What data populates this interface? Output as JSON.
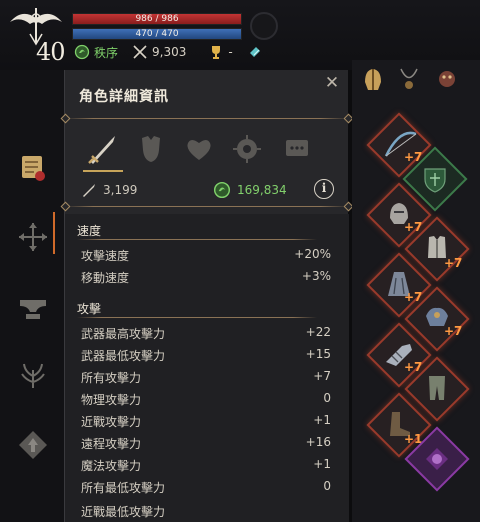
{
  "hud": {
    "level": "40",
    "hp": {
      "text": "986 / 986",
      "fraction": 1.0,
      "color": "#c33434"
    },
    "mp": {
      "text": "470 / 470",
      "fraction": 1.0,
      "color": "#3f70b8"
    },
    "alignment": "秩序",
    "combat_power": "9,303",
    "trophy_value": "-",
    "icons": [
      "class-emblem-icon",
      "alignment-icon",
      "crossed-swords-icon",
      "trophy-icon",
      "crystal-icon"
    ]
  },
  "panel": {
    "title": "角色詳細資訊",
    "close_icon": "close-icon",
    "category_tabs": [
      {
        "icon": "sword-icon",
        "selected": true
      },
      {
        "icon": "armor-icon",
        "selected": false
      },
      {
        "icon": "heart-icon",
        "selected": false
      },
      {
        "icon": "emblem-icon",
        "selected": false
      },
      {
        "icon": "chat-box-icon",
        "selected": false
      }
    ],
    "power_row": {
      "attack_power": "3,199",
      "alignment_value": "169,834",
      "info_label": "i"
    },
    "sections": [
      {
        "title": "速度",
        "rows": [
          {
            "label": "攻擊速度",
            "value": "+20%"
          },
          {
            "label": "移動速度",
            "value": "+3%"
          }
        ]
      },
      {
        "title": "攻擊",
        "rows": [
          {
            "label": "武器最高攻擊力",
            "value": "+22"
          },
          {
            "label": "武器最低攻擊力",
            "value": "+15"
          },
          {
            "label": "所有攻擊力",
            "value": "+7"
          },
          {
            "label": "物理攻擊力",
            "value": "0"
          },
          {
            "label": "近戰攻擊力",
            "value": "+1"
          },
          {
            "label": "遠程攻擊力",
            "value": "+16"
          },
          {
            "label": "魔法攻擊力",
            "value": "+1"
          },
          {
            "label": "所有最低攻擊力",
            "value": "0"
          },
          {
            "label": "近戰最低攻擊力",
            "value": ""
          }
        ]
      }
    ]
  },
  "left_nav": [
    {
      "icon": "scroll-icon",
      "active": true
    },
    {
      "icon": "move-arrows-icon",
      "active": false
    },
    {
      "icon": "anvil-icon",
      "active": false
    },
    {
      "icon": "tree-icon",
      "active": false
    },
    {
      "icon": "diamond-up-icon",
      "active": false
    }
  ],
  "equipment": {
    "tabs": [
      "helmet-tab-icon",
      "necklace-tab-icon",
      "creature-tab-icon"
    ],
    "slots": [
      {
        "item": "bow-icon",
        "enhance": "+7"
      },
      {
        "item": "shield-crest-icon",
        "enhance": ""
      },
      {
        "item": "helmet-icon",
        "enhance": "+7"
      },
      {
        "item": "chest-armor-icon",
        "enhance": "+7"
      },
      {
        "item": "cloak-icon",
        "enhance": "+7"
      },
      {
        "item": "shoulder-armor-icon",
        "enhance": "+7"
      },
      {
        "item": "gauntlet-icon",
        "enhance": "+7"
      },
      {
        "item": "leg-armor-icon",
        "enhance": ""
      },
      {
        "item": "boots-icon",
        "enhance": "+1"
      },
      {
        "item": "purple-emblem-icon",
        "enhance": ""
      }
    ],
    "colors": {
      "slot_border": "#9a3a2b",
      "enhance_text": "#ff9a42",
      "positive_green": "#82d06c"
    }
  }
}
